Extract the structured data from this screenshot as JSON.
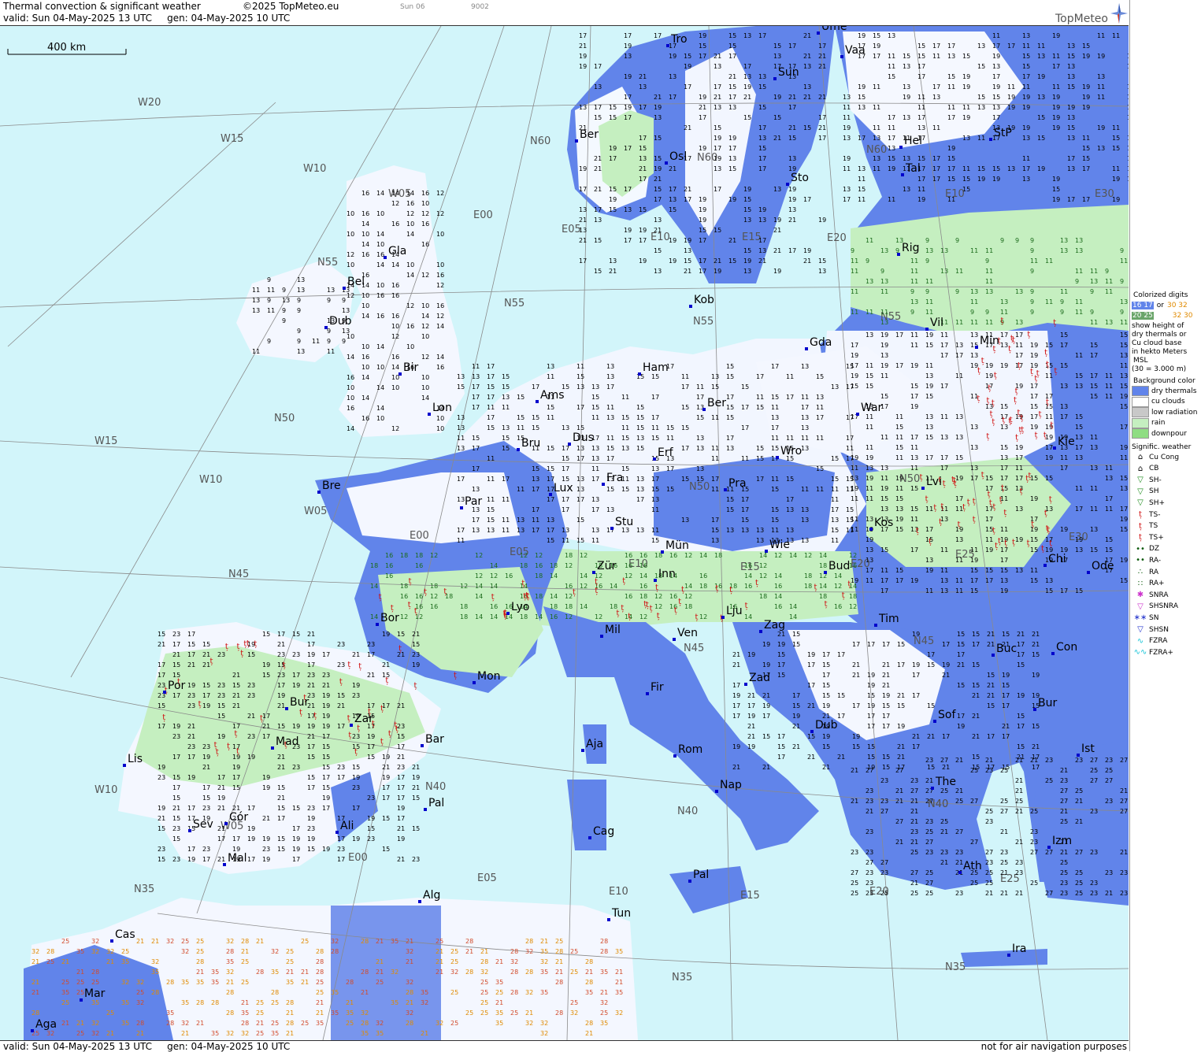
{
  "header": {
    "title": "Thermal convection & significant weather",
    "copyright": "©2025 TopMeteo.eu",
    "valid": "valid:  Sun  04-May-2025  13 UTC",
    "gen": "gen: 04-May-2025 10 UTC",
    "small_day": "Sun 06",
    "small_code": "9002",
    "logo": "TopMeteo"
  },
  "footer": {
    "valid": "valid:  Sun  04-May-2025  13 UTC",
    "gen": "gen: 04-May-2025 10 UTC",
    "disclaimer": "not for air navigation purposes"
  },
  "scale_label": "400 km",
  "colors": {
    "sea": "#d2f5fa",
    "dry_thermals": "#6184ea",
    "cu_clouds": "#ffffff",
    "low_radiation": "#c8c8c8",
    "rain": "#c5efc0",
    "downpour": "#8fdd83",
    "ts_red": "#d01010",
    "warm_digits": "#e08a00"
  },
  "legend": {
    "colorized_title": "Colorized digits",
    "or": "or",
    "sample_a": "16 17",
    "sample_b": "20 25",
    "sample_c": "30 32",
    "sample_d": "32 30",
    "desc": [
      "show height of",
      "dry thermals or",
      "Cu cloud base",
      "in hekto Meters",
      "MSL",
      "(30 = 3.000 m)"
    ],
    "bg_title": "Background color",
    "bg_items": [
      "dry thermals",
      "cu clouds",
      "low radiation",
      "rain",
      "downpour"
    ],
    "sig_title": "Signific. weather",
    "sig_items": [
      {
        "sym": "⌂",
        "label": "Cu Cong",
        "color": "#000"
      },
      {
        "sym": "⌂",
        "label": "CB",
        "color": "#000"
      },
      {
        "sym": "▽",
        "label": "SH-",
        "color": "#1a8a1a"
      },
      {
        "sym": "▽",
        "label": "SH",
        "color": "#1a8a1a"
      },
      {
        "sym": "▽",
        "label": "SH+",
        "color": "#1a8a1a"
      },
      {
        "sym": "ț",
        "label": "TS-",
        "color": "#d01010"
      },
      {
        "sym": "ț",
        "label": "TS",
        "color": "#d01010"
      },
      {
        "sym": "ț",
        "label": "TS+",
        "color": "#d01010"
      },
      {
        "sym": "••",
        "label": "DZ",
        "color": "#0b5a0b"
      },
      {
        "sym": "••",
        "label": "RA-",
        "color": "#0b5a0b"
      },
      {
        "sym": "∴",
        "label": "RA",
        "color": "#0b5a0b"
      },
      {
        "sym": "∷",
        "label": "RA+",
        "color": "#0b5a0b"
      },
      {
        "sym": "✱",
        "label": "SNRA",
        "color": "#cc33cc"
      },
      {
        "sym": "▽",
        "label": "SHSNRA",
        "color": "#cc33cc"
      },
      {
        "sym": "∗∗",
        "label": "SN",
        "color": "#2233cc"
      },
      {
        "sym": "▽",
        "label": "SHSN",
        "color": "#2233cc"
      },
      {
        "sym": "∿",
        "label": "FZRA",
        "color": "#19c5d8"
      },
      {
        "sym": "∿∿",
        "label": "FZRA+",
        "color": "#19c5d8"
      }
    ]
  },
  "grid_labels": {
    "lat": [
      "N60",
      "N55",
      "N50",
      "N45",
      "N40",
      "N35",
      "N55",
      "N60",
      "N50",
      "N45",
      "N40",
      "N35",
      "N55",
      "N45",
      "N40",
      "N35",
      "N60",
      "N55",
      "N50",
      "N40"
    ],
    "lon": [
      "W20",
      "W15",
      "W10",
      "W05",
      "E00",
      "E05",
      "E10",
      "E15",
      "E20",
      "W15",
      "W10",
      "W05",
      "E00",
      "E05",
      "E10",
      "E15",
      "E20",
      "E25",
      "E30",
      "E05",
      "E10",
      "W10",
      "W05",
      "E00",
      "E25",
      "E20",
      "E15",
      "E10",
      "E30"
    ]
  },
  "cities": [
    "Tro",
    "Ume",
    "Vaa",
    "Sun",
    "Ber",
    "Osl",
    "Sto",
    "Hel",
    "StP",
    "Tal",
    "Gla",
    "Rig",
    "Bel",
    "Kob",
    "Dub",
    "Gda",
    "Vil",
    "Min",
    "Ham",
    "Bir",
    "Ams",
    "Ber",
    "War",
    "Lon",
    "Bru",
    "Dus",
    "Erf",
    "Wro",
    "Kie",
    "Lvi",
    "Bre",
    "Fra",
    "Pra",
    "Lux",
    "Par",
    "Stu",
    "Kos",
    "Mün",
    "Wie",
    "Bud",
    "Chi",
    "Ode",
    "Zür",
    "Inn",
    "Lyo",
    "Lju",
    "Zag",
    "Tim",
    "Bor",
    "Mil",
    "Ven",
    "Buc",
    "Con",
    "Bur",
    "Por",
    "Mon",
    "Fir",
    "Zad",
    "Bur",
    "Zar",
    "Dub",
    "Sof",
    "Mad",
    "Bar",
    "Aja",
    "Rom",
    "Ist",
    "Lis",
    "Nap",
    "The",
    "Pal",
    "Cag",
    "Sev",
    "Cór",
    "Ali",
    "Izm",
    "Mal",
    "Pal",
    "Ath",
    "Alg",
    "Tun",
    "Cas",
    "Ira",
    "Mar",
    "Aga"
  ]
}
